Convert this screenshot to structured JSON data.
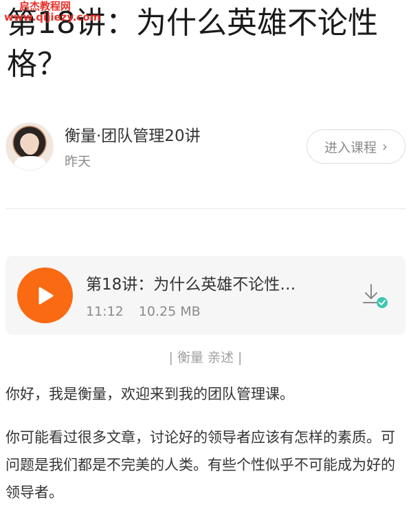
{
  "watermark": {
    "line1": "启杰教程网",
    "line2": "www.qijiezy.com"
  },
  "article": {
    "title": "第18讲：为什么英雄不论性格？"
  },
  "author": {
    "course": "衡量·团队管理20讲",
    "date": "昨天",
    "enter_label": "进入课程",
    "enter_icon": "chevron-right-icon"
  },
  "audio": {
    "title": "第18讲：为什么英雄不论性…",
    "duration": "11:12",
    "size": "10.25 MB",
    "play_icon": "play-icon",
    "download_icon": "downloaded-icon"
  },
  "narrator": "| 衡量 亲述 |",
  "body": {
    "p1": "你好，我是衡量，欢迎来到我的团队管理课。",
    "p2": "你可能看过很多文章，讨论好的领导者应该有怎样的素质。可问题是我们都是不完美的人类。有些个性似乎不可能成为好的领导者。"
  },
  "colors": {
    "accent": "#f96a12",
    "check": "#3cc7b0",
    "watermark": "#e8322b"
  }
}
